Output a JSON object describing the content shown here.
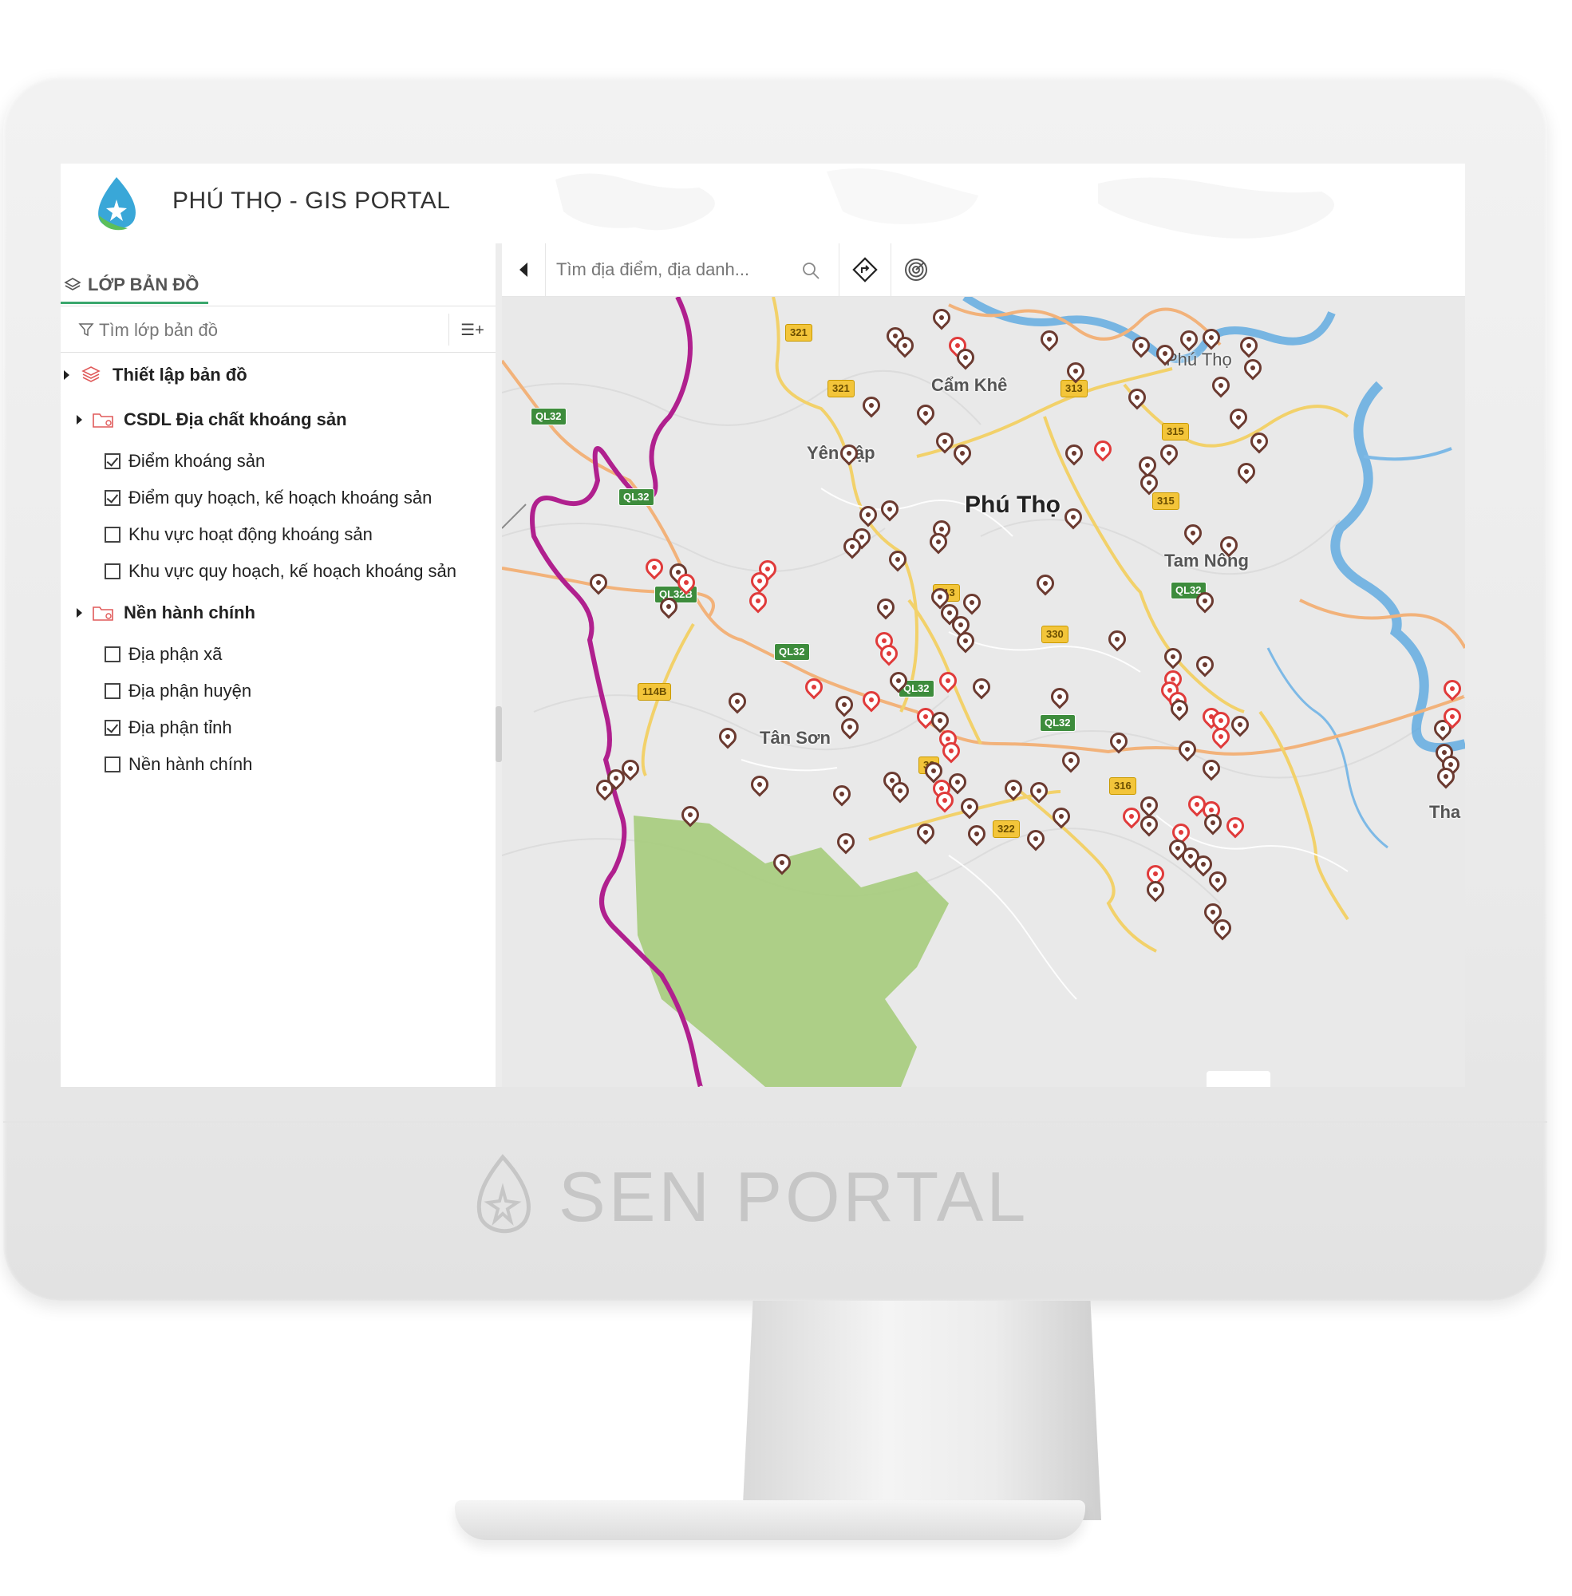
{
  "app": {
    "title": "PHÚ THỌ - GIS PORTAL",
    "brand": "SEN PORTAL",
    "accent_color": "#3aa76d"
  },
  "sidebar": {
    "tab_label": "LỚP BẢN ĐỒ",
    "tab_icon": "layers-icon",
    "search_placeholder": "Tìm lớp bản đồ",
    "add_layer_label": "☰+",
    "tree": [
      {
        "label": "Thiết lập bản đồ",
        "type": "group",
        "icon": "layers-stack-icon"
      },
      {
        "label": "CSDL Địa chất khoáng sản",
        "type": "folder",
        "icon": "folder-icon",
        "children": [
          {
            "label": "Điểm khoáng sản",
            "checked": true
          },
          {
            "label": "Điểm quy hoạch, kế hoạch khoáng sản",
            "checked": true
          },
          {
            "label": "Khu vực hoạt động khoáng sản",
            "checked": false
          },
          {
            "label": "Khu vực quy hoạch, kế hoạch khoáng sản",
            "checked": false
          }
        ]
      },
      {
        "label": "Nền hành chính",
        "type": "folder",
        "icon": "folder-icon",
        "children": [
          {
            "label": "Địa phận xã",
            "checked": false
          },
          {
            "label": "Địa phận huyện",
            "checked": false
          },
          {
            "label": "Địa phận tỉnh",
            "checked": true
          },
          {
            "label": "Nền hành chính",
            "checked": false
          }
        ]
      }
    ]
  },
  "map_toolbar": {
    "search_placeholder": "Tìm địa điểm, địa danh...",
    "buttons": [
      "collapse-panel",
      "directions",
      "radar"
    ]
  },
  "map": {
    "place_labels": [
      "Cẩm Khê",
      "Yên Lập",
      "Phú Thọ",
      "Tân Sơn",
      "Tam Nông",
      "Phú Thọ",
      "Tha"
    ],
    "road_shields": [
      "QL32",
      "QL32",
      "QL32B",
      "QL32",
      "QL32",
      "QL32",
      "QL32",
      "321",
      "321",
      "313",
      "313",
      "315",
      "315",
      "330",
      "114B",
      "316",
      "32",
      "322"
    ],
    "colors": {
      "province_border": "#b0208e",
      "national_road": "#f2b27a",
      "provincial_road": "#f2d16a",
      "river": "#5aa7e0",
      "forest": "#a6cc7c",
      "mineral_point": "#6b3a30",
      "planned_point": "#e03b3b"
    }
  }
}
